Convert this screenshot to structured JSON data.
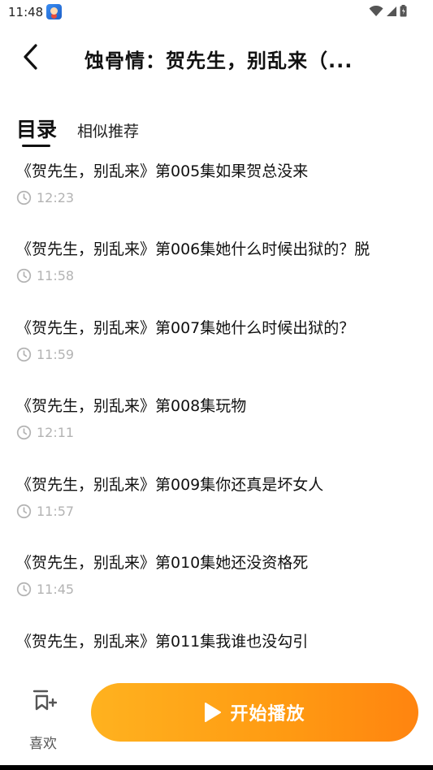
{
  "status_bar": {
    "time": "11:48",
    "app_icon": "cartoon-avatar-icon",
    "icons": [
      "wifi-icon",
      "cellular-signal-icon",
      "battery-icon"
    ]
  },
  "header": {
    "back_icon": "chevron-left-icon",
    "title": "蚀骨情：贺先生，别乱来（..."
  },
  "tabs": {
    "active_label": "目录",
    "inactive_label": "相似推荐"
  },
  "episodes": [
    {
      "title": "《贺先生，别乱来》第005集如果贺总没来",
      "time": "12:23"
    },
    {
      "title": "《贺先生，别乱来》第006集她什么时候出狱的？脱",
      "time": "11:58"
    },
    {
      "title": "《贺先生，别乱来》第007集她什么时候出狱的？",
      "time": "11:59"
    },
    {
      "title": "《贺先生，别乱来》第008集玩物",
      "time": "12:11"
    },
    {
      "title": "《贺先生，别乱来》第009集你还真是坏女人",
      "time": "11:57"
    },
    {
      "title": "《贺先生，别乱来》第010集她还没资格死",
      "time": "11:45"
    },
    {
      "title": "《贺先生，别乱来》第011集我谁也没勾引",
      "time": ""
    }
  ],
  "bottom_bar": {
    "like_label": "喜欢",
    "like_icon": "add-to-list-icon",
    "play_label": "开始播放",
    "play_icon": "play-icon"
  },
  "colors": {
    "accent_start": "#ffb21f",
    "accent_end": "#ff8410",
    "time_text": "#b3b3b3"
  }
}
